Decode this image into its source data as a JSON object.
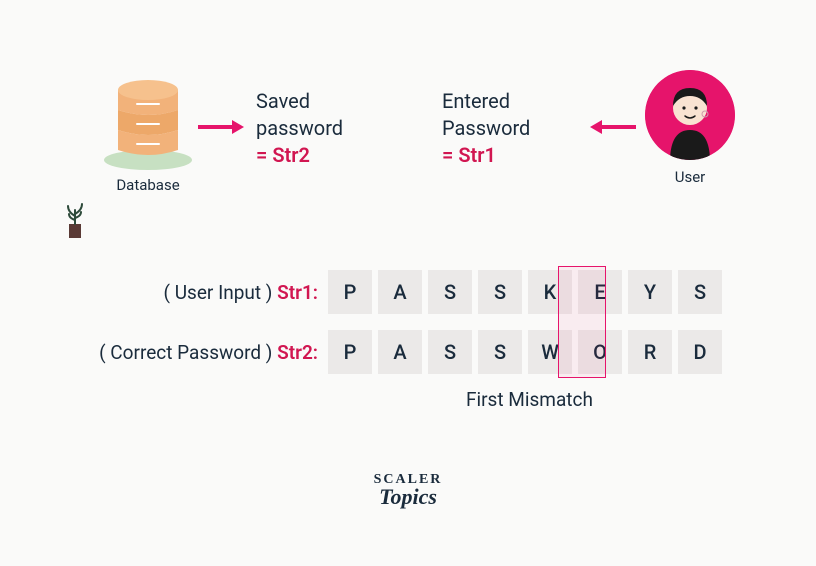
{
  "top": {
    "database_label": "Database",
    "saved": {
      "line1": "Saved",
      "line2": "password",
      "line3": "= Str2"
    },
    "entered": {
      "line1": "Entered",
      "line2": "Password",
      "line3": "= Str1"
    },
    "user_label": "User"
  },
  "rows": {
    "r1": {
      "prefix": "( User Input )",
      "name": "Str1:",
      "cells": [
        "P",
        "A",
        "S",
        "S",
        "K",
        "E",
        "Y",
        "S"
      ]
    },
    "r2": {
      "prefix": "( Correct Password )",
      "name": "Str2:",
      "cells": [
        "P",
        "A",
        "S",
        "S",
        "W",
        "O",
        "R",
        "D"
      ]
    }
  },
  "mismatch_label": "First Mismatch",
  "mismatch_index": 4,
  "footer": {
    "line1": "SCALER",
    "line2": "Topics"
  }
}
